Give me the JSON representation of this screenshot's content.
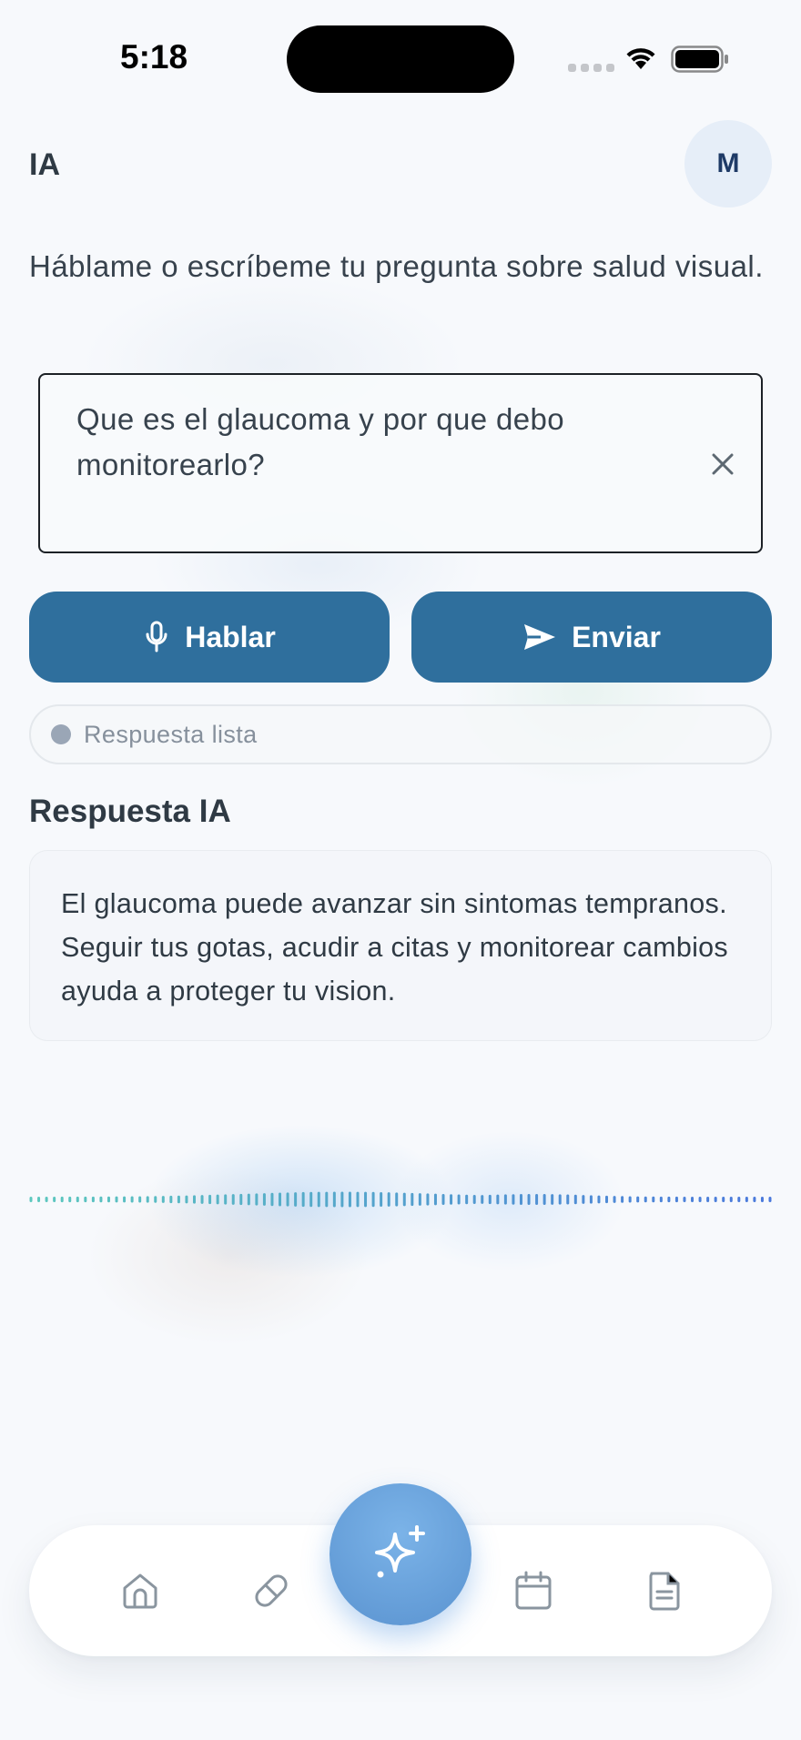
{
  "status_bar": {
    "time": "5:18"
  },
  "header": {
    "title": "IA",
    "avatar_initial": "M"
  },
  "instruction": "Háblame o escríbeme tu pregunta sobre salud visual.",
  "question": {
    "value": "Que es el glaucoma y por que debo monitorearlo?"
  },
  "buttons": {
    "speak_label": "Hablar",
    "send_label": "Enviar"
  },
  "status": {
    "text": "Respuesta lista"
  },
  "answer": {
    "title": "Respuesta IA",
    "text": "El glaucoma puede avanzar sin sintomas tempranos. Seguir tus gotas, acudir a citas y monitorear cambios ayuda a proteger tu vision."
  },
  "nav": {
    "items": [
      {
        "icon": "home-icon"
      },
      {
        "icon": "pill-icon"
      },
      {
        "icon": "sparkles-icon"
      },
      {
        "icon": "calendar-icon"
      },
      {
        "icon": "document-icon"
      }
    ]
  },
  "colors": {
    "primary_button": "#2f6f9d",
    "fab": "#5a93d0",
    "status_dot": "#9aa6b6",
    "text": "#2f3a44"
  }
}
